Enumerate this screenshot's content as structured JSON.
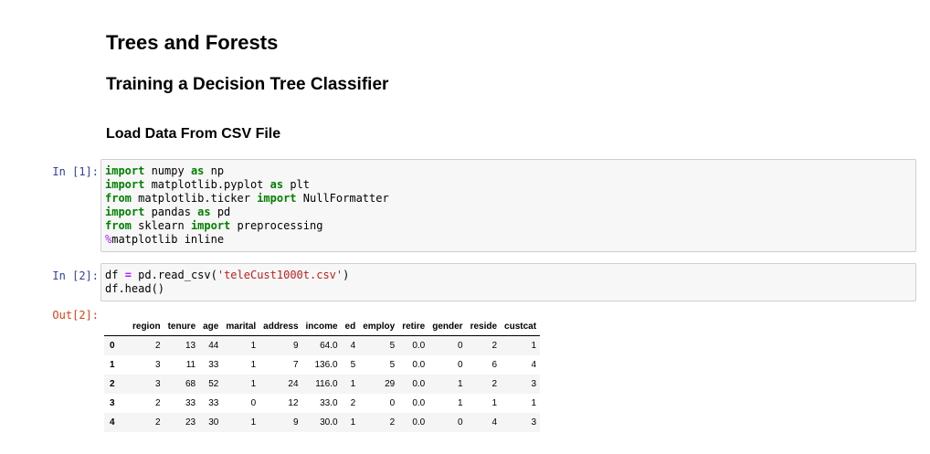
{
  "headings": {
    "h1": "Trees and Forests",
    "h2": "Training a Decision Tree Classifier",
    "h3": "Load Data From CSV File"
  },
  "cells": [
    {
      "prompt": "In [1]:",
      "lines": [
        [
          [
            "kw",
            "import"
          ],
          [
            "t",
            " numpy "
          ],
          [
            "kw",
            "as"
          ],
          [
            "t",
            " np"
          ]
        ],
        [
          [
            "kw",
            "import"
          ],
          [
            "t",
            " matplotlib.pyplot "
          ],
          [
            "kw",
            "as"
          ],
          [
            "t",
            " plt"
          ]
        ],
        [
          [
            "kw",
            "from"
          ],
          [
            "t",
            " matplotlib.ticker "
          ],
          [
            "kw",
            "import"
          ],
          [
            "t",
            " NullFormatter"
          ]
        ],
        [
          [
            "kw",
            "import"
          ],
          [
            "t",
            " pandas "
          ],
          [
            "kw",
            "as"
          ],
          [
            "t",
            " pd"
          ]
        ],
        [
          [
            "kw",
            "from"
          ],
          [
            "t",
            " sklearn "
          ],
          [
            "kw",
            "import"
          ],
          [
            "t",
            " preprocessing"
          ]
        ],
        [
          [
            "mg",
            "%"
          ],
          [
            "t",
            "matplotlib inline"
          ]
        ]
      ]
    },
    {
      "prompt": "In [2]:",
      "lines": [
        [
          [
            "t",
            "df "
          ],
          [
            "op",
            "="
          ],
          [
            "t",
            " pd.read_csv("
          ],
          [
            "str",
            "'teleCust1000t.csv'"
          ],
          [
            "t",
            ")"
          ]
        ],
        [
          [
            "t",
            "df.head()"
          ]
        ]
      ]
    }
  ],
  "output": {
    "prompt": "Out[2]:",
    "columns": [
      "",
      "region",
      "tenure",
      "age",
      "marital",
      "address",
      "income",
      "ed",
      "employ",
      "retire",
      "gender",
      "reside",
      "custcat"
    ],
    "rows": [
      [
        "0",
        "2",
        "13",
        "44",
        "1",
        "9",
        "64.0",
        "4",
        "5",
        "0.0",
        "0",
        "2",
        "1"
      ],
      [
        "1",
        "3",
        "11",
        "33",
        "1",
        "7",
        "136.0",
        "5",
        "5",
        "0.0",
        "0",
        "6",
        "4"
      ],
      [
        "2",
        "3",
        "68",
        "52",
        "1",
        "24",
        "116.0",
        "1",
        "29",
        "0.0",
        "1",
        "2",
        "3"
      ],
      [
        "3",
        "2",
        "33",
        "33",
        "0",
        "12",
        "33.0",
        "2",
        "0",
        "0.0",
        "1",
        "1",
        "1"
      ],
      [
        "4",
        "2",
        "23",
        "30",
        "1",
        "9",
        "30.0",
        "1",
        "2",
        "0.0",
        "0",
        "4",
        "3"
      ]
    ]
  }
}
